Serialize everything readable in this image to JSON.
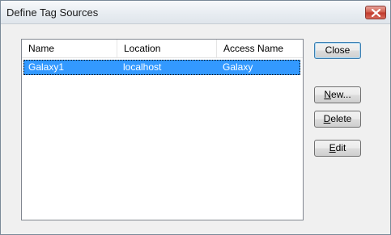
{
  "window": {
    "title": "Define Tag Sources"
  },
  "list": {
    "columns": [
      "Name",
      "Location",
      "Access Name"
    ],
    "rows": [
      {
        "name": "Galaxy1",
        "location": "localhost",
        "access_name": "Galaxy",
        "selected": true
      }
    ]
  },
  "buttons": {
    "close": "Close",
    "new_first": "N",
    "new_rest": "ew...",
    "delete_first": "D",
    "delete_rest": "elete",
    "edit_first": "E",
    "edit_rest": "dit"
  },
  "icons": {
    "title_close": "close-icon"
  },
  "colors": {
    "selection": "#3399ff",
    "title_close_button": "#c0392b"
  }
}
